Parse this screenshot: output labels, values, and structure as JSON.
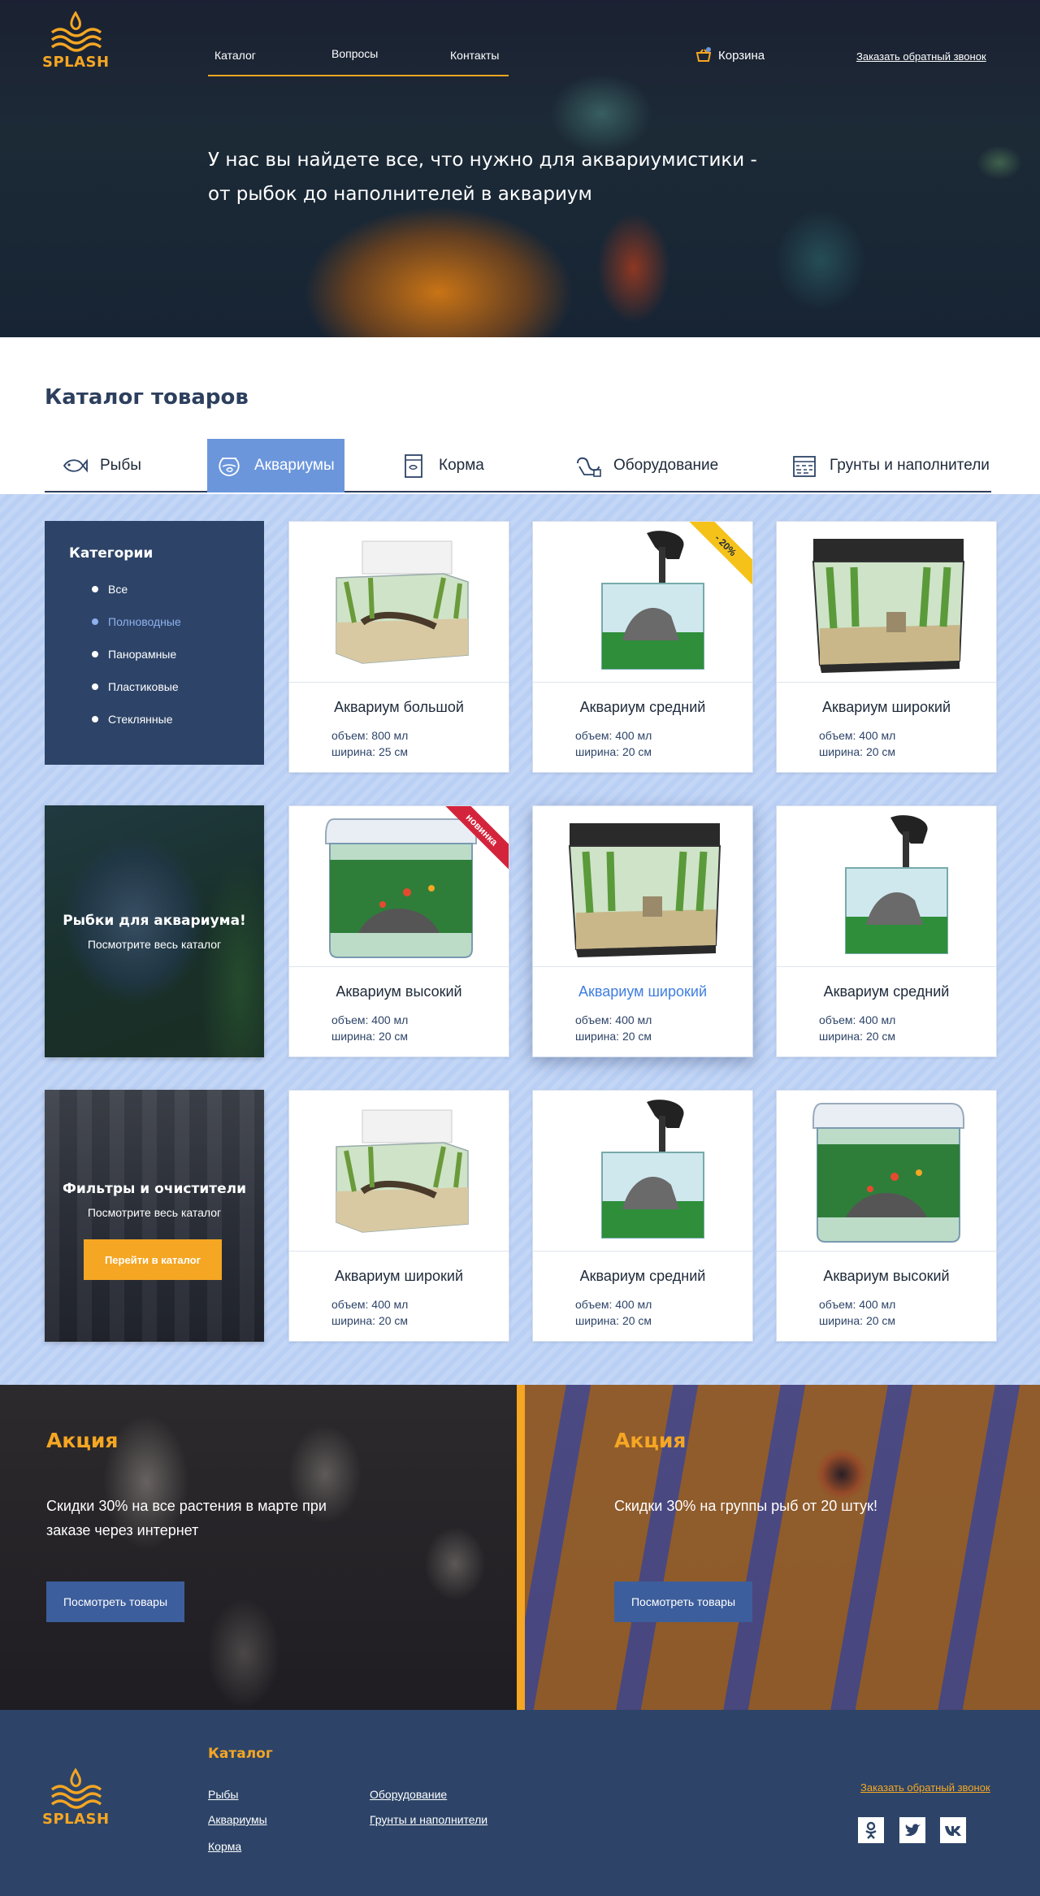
{
  "brand": {
    "name": "SPLASH",
    "accent": "#f5a623",
    "navy": "#2d4468",
    "blue": "#6b96dc"
  },
  "topnav": [
    {
      "label": "Каталог"
    },
    {
      "label": "Вопросы"
    },
    {
      "label": "Контакты"
    }
  ],
  "cart": {
    "label": "Корзина",
    "icon": "cart-icon"
  },
  "callback_label": "Заказать обратный звонок",
  "hero": {
    "line1": "У нас вы найдете все, что нужно для аквариумистики -",
    "line2": "от рыбок до наполнителей в аквариум"
  },
  "catalog": {
    "title": "Каталог товаров",
    "tabs": [
      {
        "label": "Рыбы",
        "icon": "fish-icon",
        "active": false
      },
      {
        "label": "Аквариумы",
        "icon": "fishbowl-icon",
        "active": true
      },
      {
        "label": "Корма",
        "icon": "food-can-icon",
        "active": false
      },
      {
        "label": "Оборудование",
        "icon": "hose-icon",
        "active": false
      },
      {
        "label": "Грунты и наполнители",
        "icon": "substrate-icon",
        "active": false
      }
    ],
    "categories": {
      "title": "Категории",
      "items": [
        {
          "label": "Все",
          "selected": false
        },
        {
          "label": "Полноводные",
          "selected": true
        },
        {
          "label": "Панорамные",
          "selected": false
        },
        {
          "label": "Пластиковые",
          "selected": false
        },
        {
          "label": "Стеклянные",
          "selected": false
        }
      ]
    },
    "promos": [
      {
        "title": "Рыбки для аквариума!",
        "sub": "Посмотрите весь каталог"
      },
      {
        "title": "Фильтры и очистители",
        "sub": "Посмотрите весь каталог",
        "button": "Перейти в каталог"
      }
    ],
    "products": [
      {
        "name": "Аквариум большой",
        "volume": "объем: 800 мл",
        "width": "ширина: 25 см",
        "img": "cube",
        "badge": ""
      },
      {
        "name": "Аквариум средний",
        "volume": "объем: 400 мл",
        "width": "ширина: 20 см",
        "img": "nano",
        "badge": "- 20%"
      },
      {
        "name": "Аквариум широкий",
        "volume": "объем: 400 мл",
        "width": "ширина: 20 см",
        "img": "wide",
        "badge": ""
      },
      {
        "name": "Аквариум высокий",
        "volume": "объем: 400 мл",
        "width": "ширина: 20 см",
        "img": "tall",
        "badge": "новинка"
      },
      {
        "name": "Аквариум широкий",
        "volume": "объем: 400 мл",
        "width": "ширина: 20 см",
        "img": "wide",
        "badge": ""
      },
      {
        "name": "Аквариум средний",
        "volume": "объем: 400 мл",
        "width": "ширина: 20 см",
        "img": "nano",
        "badge": ""
      },
      {
        "name": "Аквариум широкий",
        "volume": "объем: 400 мл",
        "width": "ширина: 20 см",
        "img": "cube",
        "badge": ""
      },
      {
        "name": "Аквариум средний",
        "volume": "объем: 400 мл",
        "width": "ширина: 20 см",
        "img": "nano",
        "badge": ""
      },
      {
        "name": "Аквариум высокий",
        "volume": "объем: 400 мл",
        "width": "ширина: 20 см",
        "img": "tall",
        "badge": ""
      }
    ]
  },
  "akciya": [
    {
      "title": "Акция",
      "text": "Скидки 30% на все растения в марте при заказе через интернет",
      "button": "Посмотреть товары"
    },
    {
      "title": "Акция",
      "text": "Скидки 30% на группы рыб от 20 штук!",
      "button": "Посмотреть товары"
    }
  ],
  "footer": {
    "catalog_title": "Каталог",
    "links": [
      "Рыбы",
      "Аквариумы",
      "Корма",
      "Оборудование",
      "Грунты и наполнители"
    ],
    "callback_label": "Заказать обратный звонок",
    "social": [
      "odnoklassniki-icon",
      "twitter-icon",
      "vk-icon"
    ]
  }
}
